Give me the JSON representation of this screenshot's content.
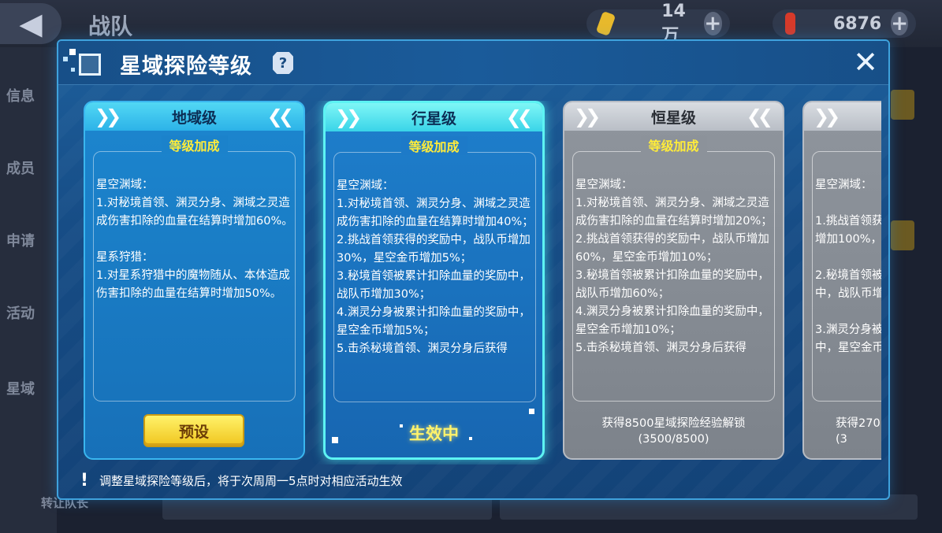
{
  "background": {
    "title": "战队",
    "currencies": [
      {
        "name": "gold",
        "value": "14万",
        "icon": "coin-icon",
        "color": "#e7b92c"
      },
      {
        "name": "gem",
        "value": "6876",
        "icon": "crystal-icon",
        "color": "#d63a2a"
      }
    ],
    "left_menu": [
      "信息",
      "成员",
      "申请",
      "活动",
      "星域"
    ],
    "bottom_left_label": "转让队长"
  },
  "modal": {
    "title": "星域探险等级",
    "help_icon": "?",
    "close_icon": "✕"
  },
  "cards": [
    {
      "name": "地域级",
      "state": "preset",
      "bonus_title": "等级加成",
      "bonus_text": "星空渊域：\n1.对秘境首领、渊灵分身、渊域之灵造成伤害扣除的血量在结算时增加60%。\n\n星系狩猎：\n1.对星系狩猎中的魔物随从、本体造成伤害扣除的血量在结算时增加50%。",
      "button_label": "预设"
    },
    {
      "name": "行星级",
      "state": "active",
      "bonus_title": "等级加成",
      "bonus_text": "星空渊域：\n1.对秘境首领、渊灵分身、渊域之灵造成伤害扣除的血量在结算时增加40%；\n2.挑战首领获得的奖励中，战队币增加30%，星空金币增加5%；\n3.秘境首领被累计扣除血量的奖励中，战队币增加30%；\n4.渊灵分身被累计扣除血量的奖励中，星空金币增加5%；\n5.击杀秘境首领、渊灵分身后获得",
      "status_label": "生效中"
    },
    {
      "name": "恒星级",
      "state": "locked",
      "bonus_title": "等级加成",
      "bonus_text": "星空渊域：\n1.对秘境首领、渊灵分身、渊域之灵造成伤害扣除的血量在结算时增加20%；\n2.挑战首领获得的奖励中，战队币增加60%，星空金币增加10%；\n3.秘境首领被累计扣除血量的奖励中，战队币增加60%；\n4.渊灵分身被累计扣除血量的奖励中，星空金币增加10%；\n5.击杀秘境首领、渊灵分身后获得",
      "unlock_text": "获得8500星域探险经验解锁",
      "progress_text": "(3500/8500)"
    },
    {
      "name": "",
      "state": "locked",
      "bonus_title": "",
      "bonus_text": "星空渊域：\n\n1.挑战首领获\n增加100%，\n\n2.秘境首领被\n中，战队币增\n\n3.渊灵分身被\n中，星空金币",
      "unlock_text": "获得270",
      "progress_text": "(3"
    }
  ],
  "footer": {
    "notice_icon": "!",
    "text": "调整星域探险等级后，将于次周周一5点时对相应活动生效"
  }
}
